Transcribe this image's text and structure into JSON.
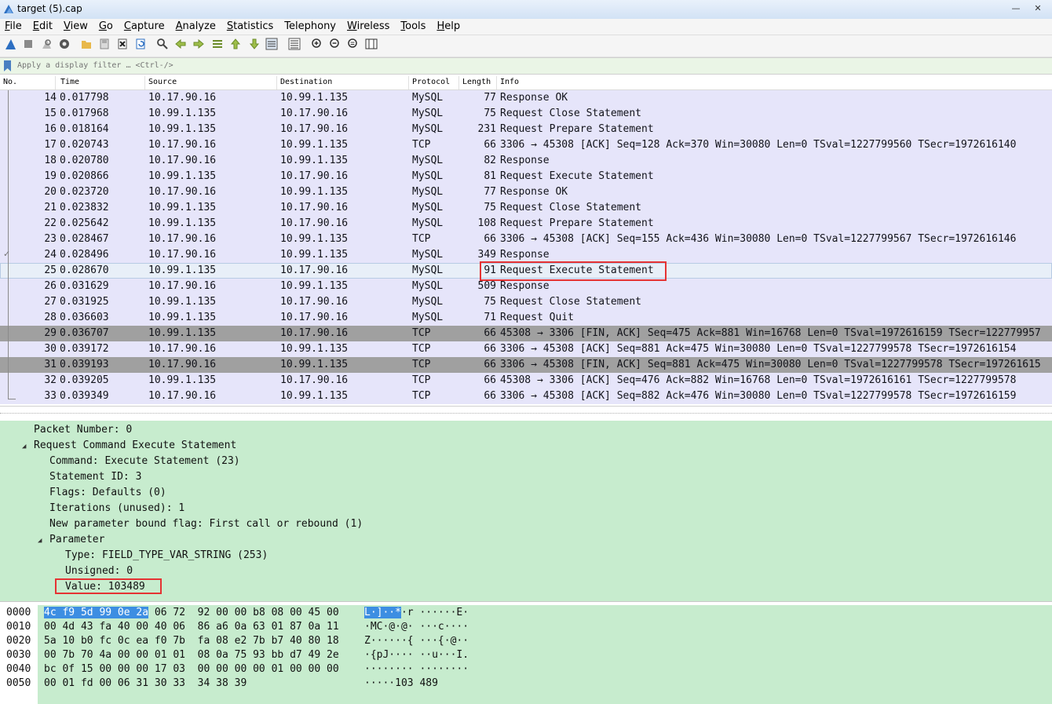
{
  "window": {
    "title": "target (5).cap"
  },
  "menu": [
    {
      "label": "File",
      "ul": "F",
      "rest": "ile"
    },
    {
      "label": "Edit",
      "ul": "E",
      "rest": "dit"
    },
    {
      "label": "View",
      "ul": "V",
      "rest": "iew"
    },
    {
      "label": "Go",
      "ul": "G",
      "rest": "o"
    },
    {
      "label": "Capture",
      "ul": "C",
      "rest": "apture"
    },
    {
      "label": "Analyze",
      "ul": "A",
      "rest": "nalyze"
    },
    {
      "label": "Statistics",
      "ul": "S",
      "rest": "tatistics"
    },
    {
      "label": "Telephony",
      "ul": "",
      "rest": "Telephony"
    },
    {
      "label": "Wireless",
      "ul": "W",
      "rest": "ireless"
    },
    {
      "label": "Tools",
      "ul": "T",
      "rest": "ools"
    },
    {
      "label": "Help",
      "ul": "H",
      "rest": "elp"
    }
  ],
  "filter": {
    "placeholder": "Apply a display filter … <Ctrl-/>"
  },
  "columns": {
    "no": "No.",
    "time": "Time",
    "source": "Source",
    "destination": "Destination",
    "protocol": "Protocol",
    "length": "Length",
    "info": "Info"
  },
  "packets": [
    {
      "no": "14",
      "time": "0.017798",
      "src": "10.17.90.16",
      "dst": "10.99.1.135",
      "proto": "MySQL",
      "len": "77",
      "info": "Response OK",
      "style": "normal"
    },
    {
      "no": "15",
      "time": "0.017968",
      "src": "10.99.1.135",
      "dst": "10.17.90.16",
      "proto": "MySQL",
      "len": "75",
      "info": "Request Close Statement",
      "style": "normal"
    },
    {
      "no": "16",
      "time": "0.018164",
      "src": "10.99.1.135",
      "dst": "10.17.90.16",
      "proto": "MySQL",
      "len": "231",
      "info": "Request Prepare Statement",
      "style": "normal"
    },
    {
      "no": "17",
      "time": "0.020743",
      "src": "10.17.90.16",
      "dst": "10.99.1.135",
      "proto": "TCP",
      "len": "66",
      "info": "3306 → 45308 [ACK] Seq=128 Ack=370 Win=30080 Len=0 TSval=1227799560 TSecr=1972616140",
      "style": "normal"
    },
    {
      "no": "18",
      "time": "0.020780",
      "src": "10.17.90.16",
      "dst": "10.99.1.135",
      "proto": "MySQL",
      "len": "82",
      "info": "Response",
      "style": "normal"
    },
    {
      "no": "19",
      "time": "0.020866",
      "src": "10.99.1.135",
      "dst": "10.17.90.16",
      "proto": "MySQL",
      "len": "81",
      "info": "Request Execute Statement",
      "style": "normal"
    },
    {
      "no": "20",
      "time": "0.023720",
      "src": "10.17.90.16",
      "dst": "10.99.1.135",
      "proto": "MySQL",
      "len": "77",
      "info": "Response OK",
      "style": "normal"
    },
    {
      "no": "21",
      "time": "0.023832",
      "src": "10.99.1.135",
      "dst": "10.17.90.16",
      "proto": "MySQL",
      "len": "75",
      "info": "Request Close Statement",
      "style": "normal"
    },
    {
      "no": "22",
      "time": "0.025642",
      "src": "10.99.1.135",
      "dst": "10.17.90.16",
      "proto": "MySQL",
      "len": "108",
      "info": "Request Prepare Statement",
      "style": "normal"
    },
    {
      "no": "23",
      "time": "0.028467",
      "src": "10.17.90.16",
      "dst": "10.99.1.135",
      "proto": "TCP",
      "len": "66",
      "info": "3306 → 45308 [ACK] Seq=155 Ack=436 Win=30080 Len=0 TSval=1227799567 TSecr=1972616146",
      "style": "normal"
    },
    {
      "no": "24",
      "time": "0.028496",
      "src": "10.17.90.16",
      "dst": "10.99.1.135",
      "proto": "MySQL",
      "len": "349",
      "info": "Response",
      "style": "normal"
    },
    {
      "no": "25",
      "time": "0.028670",
      "src": "10.99.1.135",
      "dst": "10.17.90.16",
      "proto": "MySQL",
      "len": "91",
      "info": "Request Execute Statement",
      "style": "selected"
    },
    {
      "no": "26",
      "time": "0.031629",
      "src": "10.17.90.16",
      "dst": "10.99.1.135",
      "proto": "MySQL",
      "len": "509",
      "info": "Response",
      "style": "normal"
    },
    {
      "no": "27",
      "time": "0.031925",
      "src": "10.99.1.135",
      "dst": "10.17.90.16",
      "proto": "MySQL",
      "len": "75",
      "info": "Request Close Statement",
      "style": "normal"
    },
    {
      "no": "28",
      "time": "0.036603",
      "src": "10.99.1.135",
      "dst": "10.17.90.16",
      "proto": "MySQL",
      "len": "71",
      "info": "Request Quit",
      "style": "normal"
    },
    {
      "no": "29",
      "time": "0.036707",
      "src": "10.99.1.135",
      "dst": "10.17.90.16",
      "proto": "TCP",
      "len": "66",
      "info": "45308 → 3306 [FIN, ACK] Seq=475 Ack=881 Win=16768 Len=0 TSval=1972616159 TSecr=122779957",
      "style": "fin"
    },
    {
      "no": "30",
      "time": "0.039172",
      "src": "10.17.90.16",
      "dst": "10.99.1.135",
      "proto": "TCP",
      "len": "66",
      "info": "3306 → 45308 [ACK] Seq=881 Ack=475 Win=30080 Len=0 TSval=1227799578 TSecr=1972616154",
      "style": "normal"
    },
    {
      "no": "31",
      "time": "0.039193",
      "src": "10.17.90.16",
      "dst": "10.99.1.135",
      "proto": "TCP",
      "len": "66",
      "info": "3306 → 45308 [FIN, ACK] Seq=881 Ack=475 Win=30080 Len=0 TSval=1227799578 TSecr=197261615",
      "style": "fin"
    },
    {
      "no": "32",
      "time": "0.039205",
      "src": "10.99.1.135",
      "dst": "10.17.90.16",
      "proto": "TCP",
      "len": "66",
      "info": "45308 → 3306 [ACK] Seq=476 Ack=882 Win=16768 Len=0 TSval=1972616161 TSecr=1227799578",
      "style": "normal"
    },
    {
      "no": "33",
      "time": "0.039349",
      "src": "10.17.90.16",
      "dst": "10.99.1.135",
      "proto": "TCP",
      "len": "66",
      "info": "3306 → 45308 [ACK] Seq=882 Ack=476 Win=30080 Len=0 TSval=1227799578 TSecr=1972616159",
      "style": "normal"
    }
  ],
  "details": [
    {
      "text": "Packet Number: 0",
      "indent": 0,
      "arrow": ""
    },
    {
      "text": "Request Command Execute Statement",
      "indent": 0,
      "arrow": "expanded"
    },
    {
      "text": "Command: Execute Statement (23)",
      "indent": 1,
      "arrow": ""
    },
    {
      "text": "Statement ID: 3",
      "indent": 1,
      "arrow": ""
    },
    {
      "text": "Flags: Defaults (0)",
      "indent": 1,
      "arrow": ""
    },
    {
      "text": "Iterations (unused): 1",
      "indent": 1,
      "arrow": ""
    },
    {
      "text": "New parameter bound flag: First call or rebound (1)",
      "indent": 1,
      "arrow": ""
    },
    {
      "text": "Parameter",
      "indent": 1,
      "arrow": "expanded"
    },
    {
      "text": "Type: FIELD_TYPE_VAR_STRING (253)",
      "indent": 2,
      "arrow": ""
    },
    {
      "text": "Unsigned: 0",
      "indent": 2,
      "arrow": ""
    },
    {
      "text": "Value: 103489",
      "indent": 2,
      "arrow": ""
    }
  ],
  "bytes": [
    {
      "offset": "0000",
      "hex_hl": "4c f9 5d 99 0e 2a",
      "hex": " 06 72  92 00 00 b8 08 00 45 00",
      "ascii_hl": "L·]··*",
      "ascii": "·r ······E·"
    },
    {
      "offset": "0010",
      "hex_hl": "",
      "hex": "00 4d 43 fa 40 00 40 06  86 a6 0a 63 01 87 0a 11",
      "ascii_hl": "",
      "ascii": "·MC·@·@· ···c····"
    },
    {
      "offset": "0020",
      "hex_hl": "",
      "hex": "5a 10 b0 fc 0c ea f0 7b  fa 08 e2 7b b7 40 80 18",
      "ascii_hl": "",
      "ascii": "Z······{ ···{·@··"
    },
    {
      "offset": "0030",
      "hex_hl": "",
      "hex": "00 7b 70 4a 00 00 01 01  08 0a 75 93 bb d7 49 2e",
      "ascii_hl": "",
      "ascii": "·{pJ···· ··u···I."
    },
    {
      "offset": "0040",
      "hex_hl": "",
      "hex": "bc 0f 15 00 00 00 17 03  00 00 00 00 01 00 00 00",
      "ascii_hl": "",
      "ascii": "········ ········"
    },
    {
      "offset": "0050",
      "hex_hl": "",
      "hex": "00 01 fd 00 06 31 30 33  34 38 39",
      "ascii_hl": "",
      "ascii": "·····103 489"
    }
  ],
  "colors": {
    "row_normal": "#e6e5fa",
    "row_fin": "#a0a0a0",
    "row_selected": "#e8eff8",
    "details_bg": "#c7ecce",
    "highlight": "#3d8ee2",
    "annotation_box": "#e53333"
  },
  "toolbar_icons": [
    "shark-fin-start-icon",
    "stop-icon",
    "restart-icon",
    "capture-options-icon",
    "open-file-icon",
    "save-file-icon",
    "close-file-icon",
    "reload-file-icon",
    "find-packet-icon",
    "go-back-icon",
    "go-forward-icon",
    "go-to-packet-icon",
    "go-first-icon",
    "go-last-icon",
    "autoscroll-icon",
    "colorize-icon",
    "zoom-in-icon",
    "zoom-out-icon",
    "zoom-normal-icon",
    "resize-columns-icon"
  ]
}
